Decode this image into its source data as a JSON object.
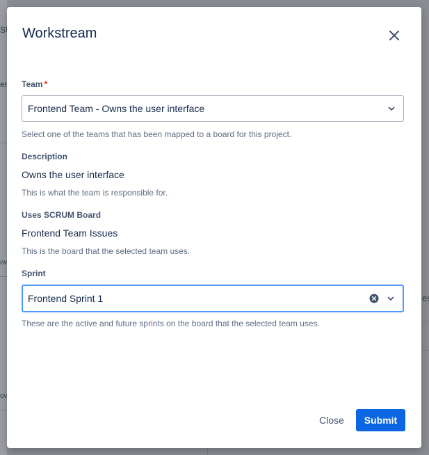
{
  "background": {
    "fragments": [
      "SU",
      "er",
      "ov",
      "ov",
      "es"
    ]
  },
  "modal": {
    "title": "Workstream",
    "close_icon": "close-icon"
  },
  "team": {
    "label": "Team",
    "required_mark": "*",
    "value": "Frontend Team - Owns the user interface",
    "helper": "Select one of the teams that has been mapped to a board for this project."
  },
  "description": {
    "label": "Description",
    "value": "Owns the user interface",
    "helper": "This is what the team is responsible for."
  },
  "board": {
    "label": "Uses SCRUM Board",
    "value": "Frontend Team Issues",
    "helper": "This is the board that the selected team uses."
  },
  "sprint": {
    "label": "Sprint",
    "value": "Frontend Sprint 1",
    "helper": "These are the active and future sprints on the board that the selected team uses."
  },
  "footer": {
    "close_label": "Close",
    "submit_label": "Submit"
  },
  "colors": {
    "primary": "#0c66e4",
    "focus_ring": "#4c9aff",
    "required": "#de350b",
    "text": "#172b4d"
  }
}
